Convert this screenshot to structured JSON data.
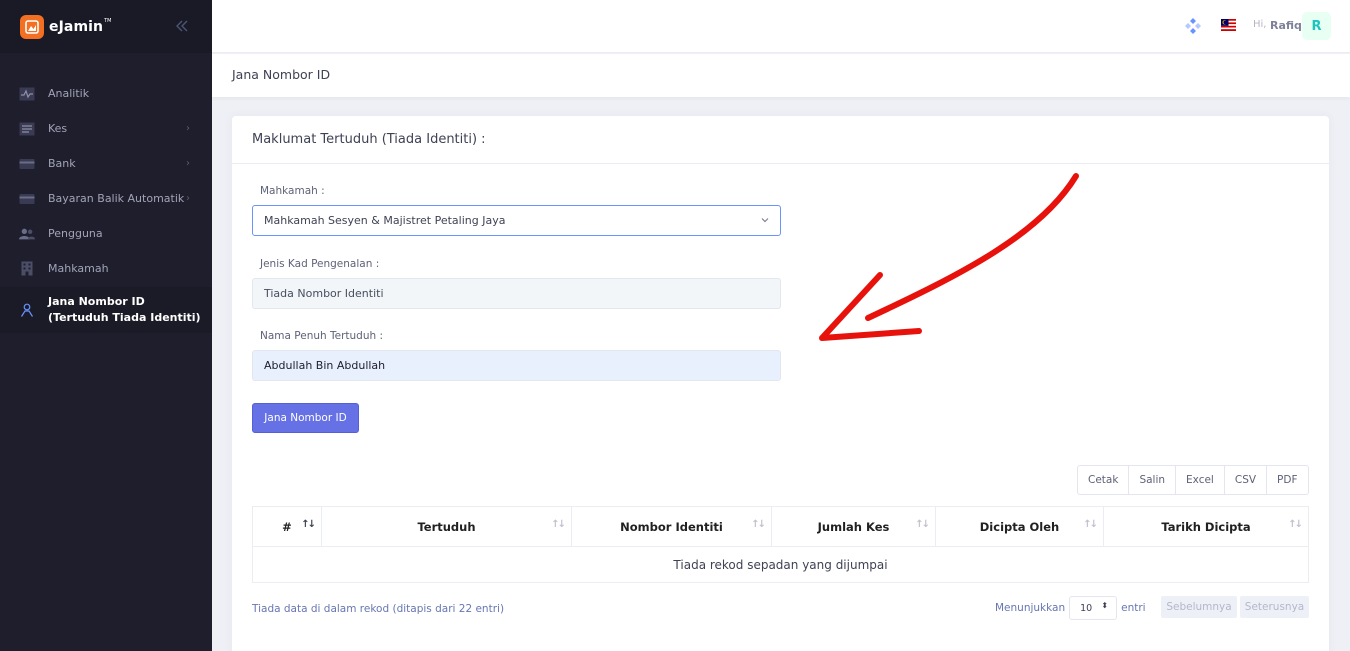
{
  "brand": {
    "name": "eJamin",
    "tm": "TM",
    "accent": "#f36f21"
  },
  "sidebar": {
    "items": [
      {
        "label": "Analitik",
        "icon": "activity-icon",
        "chevron": false
      },
      {
        "label": "Kes",
        "icon": "list-icon",
        "chevron": true
      },
      {
        "label": "Bank",
        "icon": "card-icon",
        "chevron": true
      },
      {
        "label": "Bayaran Balik Automatik",
        "icon": "card-icon",
        "chevron": true
      },
      {
        "label": "Pengguna",
        "icon": "users-icon",
        "chevron": false
      },
      {
        "label": "Mahkamah",
        "icon": "building-icon",
        "chevron": false
      },
      {
        "label": "Jana Nombor ID\n(Tertuduh Tiada Identiti)",
        "icon": "person-icon",
        "chevron": false,
        "active": true
      }
    ]
  },
  "header": {
    "greeting": "Hi,",
    "user": "Rafiq",
    "avatar": "R"
  },
  "subheader": {
    "title": "Jana Nombor ID"
  },
  "card": {
    "title": "Maklumat Tertuduh (Tiada Identiti) :",
    "court_label": "Mahkamah :",
    "court_value": "Mahkamah Sesyen & Majistret Petaling Jaya",
    "idtype_label": "Jenis Kad Pengenalan :",
    "idtype_value": "Tiada Nombor Identiti",
    "name_label": "Nama Penuh Tertuduh :",
    "name_value": "Abdullah Bin Abdullah",
    "submit_label": "Jana Nombor ID"
  },
  "export": [
    "Cetak",
    "Salin",
    "Excel",
    "CSV",
    "PDF"
  ],
  "table": {
    "columns": [
      "#",
      "Tertuduh",
      "Nombor Identiti",
      "Jumlah Kes",
      "Dicipta Oleh",
      "Tarikh Dicipta"
    ],
    "empty": "Tiada rekod sepadan yang dijumpai",
    "info": "Tiada data di dalam rekod (ditapis dari 22 entri)",
    "show_label": "Menunjukkan",
    "page_size": "10",
    "entries_label": "entri",
    "prev": "Sebelumnya",
    "next": "Seterusnya"
  },
  "annotation": {
    "color": "#e8120c"
  }
}
